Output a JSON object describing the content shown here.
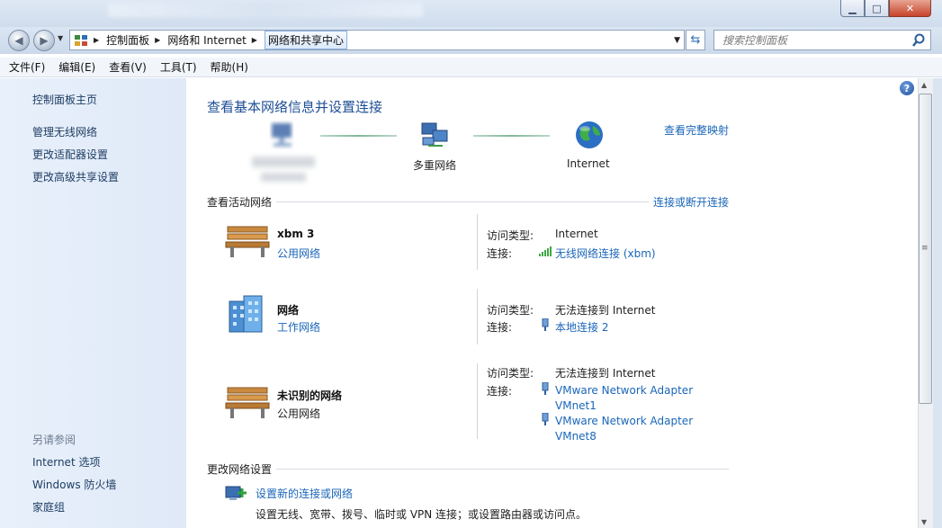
{
  "window": {
    "controls": {
      "minimize": "▁",
      "maximize": "□",
      "close": "✕"
    }
  },
  "nav": {
    "breadcrumbs": [
      "控制面板",
      "网络和 Internet",
      "网络和共享中心"
    ],
    "search_placeholder": "搜索控制面板"
  },
  "menu": [
    "文件(F)",
    "编辑(E)",
    "查看(V)",
    "工具(T)",
    "帮助(H)"
  ],
  "sidebar": {
    "home": "控制面板主页",
    "links": [
      "管理无线网络",
      "更改适配器设置",
      "更改高级共享设置"
    ],
    "see_also_title": "另请参阅",
    "see_also": [
      "Internet 选项",
      "Windows 防火墙",
      "家庭组"
    ]
  },
  "main": {
    "title": "查看基本网络信息并设置连接",
    "map": {
      "computer_name": "",
      "middle_label": "多重网络",
      "internet_label": "Internet",
      "full_map_link": "查看完整映射"
    },
    "active_header": "查看活动网络",
    "connect_link": "连接或断开连接",
    "networks": [
      {
        "name": "xbm  3",
        "type": "公用网络",
        "type_is_link": true,
        "access_label": "访问类型:",
        "access": "Internet",
        "conn_label": "连接:",
        "connections": [
          "无线网络连接 (xbm)"
        ]
      },
      {
        "name": "网络",
        "type": "工作网络",
        "type_is_link": true,
        "access_label": "访问类型:",
        "access": "无法连接到 Internet",
        "conn_label": "连接:",
        "connections": [
          "本地连接 2"
        ]
      },
      {
        "name": "未识别的网络",
        "type": "公用网络",
        "type_is_link": false,
        "access_label": "访问类型:",
        "access": "无法连接到 Internet",
        "conn_label": "连接:",
        "connections": [
          "VMware Network Adapter VMnet1",
          "VMware Network Adapter VMnet8"
        ]
      }
    ],
    "change_header": "更改网络设置",
    "setup_link": "设置新的连接或网络",
    "setup_desc": "设置无线、宽带、拨号、临时或 VPN 连接；或设置路由器或访问点。"
  },
  "colors": {
    "link": "#1a66b8",
    "title": "#1e4f95",
    "sidebar_bg": "#e2ebf8"
  }
}
